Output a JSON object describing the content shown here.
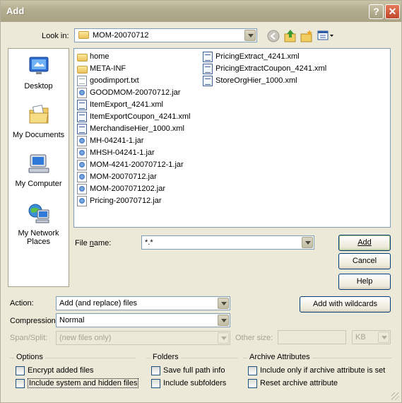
{
  "window": {
    "title": "Add",
    "help_glyph": "?",
    "close_glyph": "✕"
  },
  "lookin": {
    "label": "Look in:",
    "value": "MOM-20070712",
    "toolbar_icons": [
      "back-icon",
      "up-folder-icon",
      "new-folder-icon",
      "views-menu-icon"
    ]
  },
  "places": [
    {
      "label": "Desktop",
      "icon": "desktop-icon"
    },
    {
      "label": "My Documents",
      "icon": "my-documents-icon"
    },
    {
      "label": "My Computer",
      "icon": "my-computer-icon"
    },
    {
      "label": "My Network Places",
      "icon": "network-places-icon"
    }
  ],
  "files_col1": [
    {
      "name": "home",
      "type": "folder"
    },
    {
      "name": "META-INF",
      "type": "folder"
    },
    {
      "name": "goodimport.txt",
      "type": "doc"
    },
    {
      "name": "GOODMOM-20070712.jar",
      "type": "jar"
    },
    {
      "name": "ItemExport_4241.xml",
      "type": "xml"
    },
    {
      "name": "ItemExportCoupon_4241.xml",
      "type": "xml"
    },
    {
      "name": "MerchandiseHier_1000.xml",
      "type": "xml"
    },
    {
      "name": "MH-04241-1.jar",
      "type": "jar"
    },
    {
      "name": "MHSH-04241-1.jar",
      "type": "jar"
    },
    {
      "name": "MOM-4241-20070712-1.jar",
      "type": "jar"
    },
    {
      "name": "MOM-20070712.jar",
      "type": "jar"
    },
    {
      "name": "MOM-2007071202.jar",
      "type": "jar"
    },
    {
      "name": "Pricing-20070712.jar",
      "type": "jar"
    }
  ],
  "files_col2": [
    {
      "name": "PricingExtract_4241.xml",
      "type": "xml"
    },
    {
      "name": "PricingExtractCoupon_4241.xml",
      "type": "xml"
    },
    {
      "name": "StoreOrgHier_1000.xml",
      "type": "xml"
    }
  ],
  "filename": {
    "label": "File name:",
    "value": "*.*"
  },
  "buttons": {
    "add": "Add",
    "cancel": "Cancel",
    "help": "Help",
    "wildcards": "Add with wildcards"
  },
  "action": {
    "label": "Action:",
    "value": "Add (and replace) files"
  },
  "compression": {
    "label": "Compression:",
    "value": "Normal"
  },
  "span": {
    "label": "Span/Split:",
    "value": "(new files only)"
  },
  "other_size": {
    "label": "Other size:",
    "value": "",
    "unit": "KB"
  },
  "options": {
    "title": "Options",
    "items": [
      "Encrypt added files",
      "Include system and hidden files"
    ]
  },
  "folders": {
    "title": "Folders",
    "items": [
      "Save full path info",
      "Include subfolders"
    ]
  },
  "archive": {
    "title": "Archive Attributes",
    "items": [
      "Include only if archive attribute is set",
      "Reset archive attribute"
    ]
  }
}
